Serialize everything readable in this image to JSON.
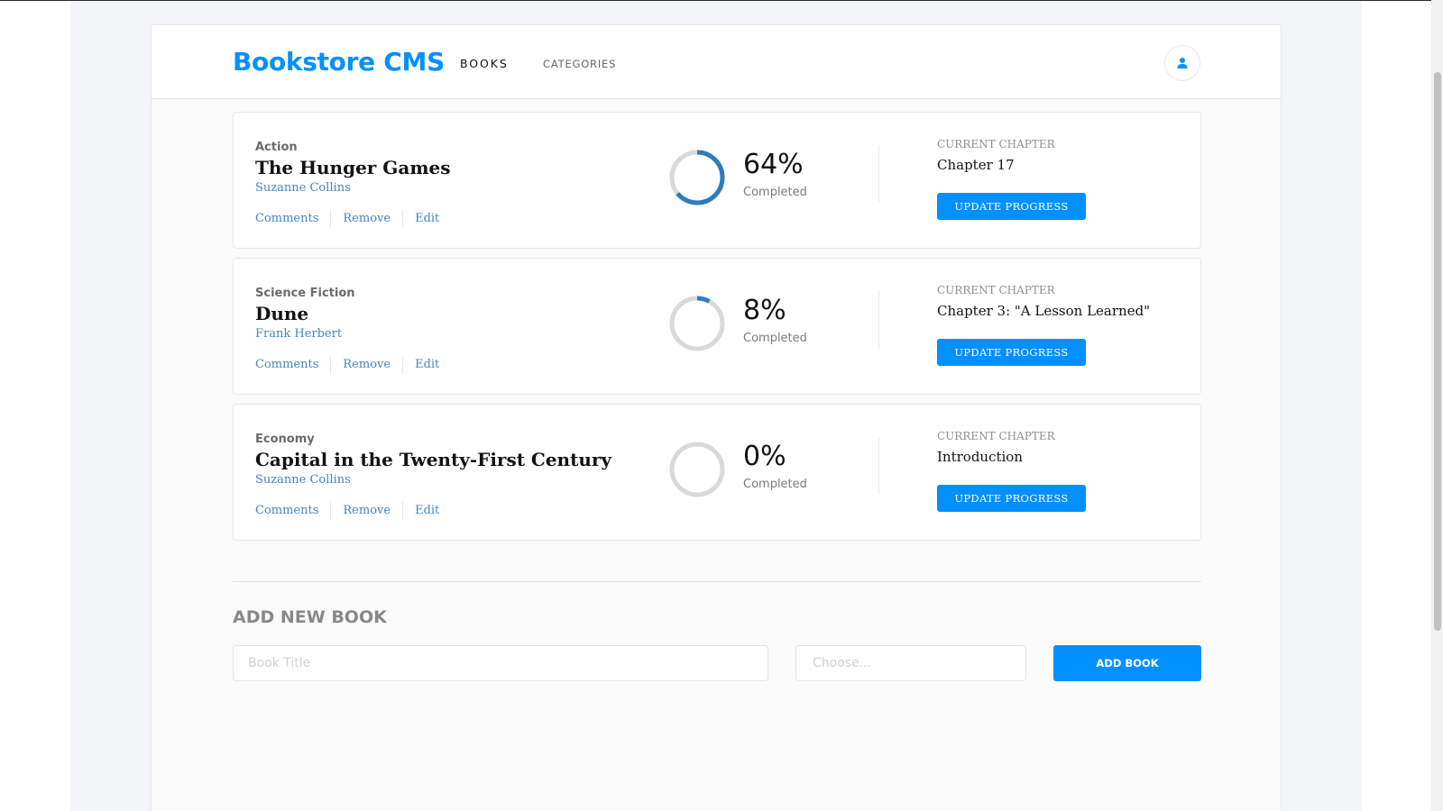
{
  "app": {
    "logo": "Bookstore CMS",
    "accent_color": "#0290ff"
  },
  "nav": {
    "books": "BOOKS",
    "categories": "CATEGORIES"
  },
  "user": {
    "icon": "user-icon"
  },
  "books": [
    {
      "genre": "Action",
      "title": "The Hunger Games",
      "author": "Suzanne Collins",
      "actions": [
        "Comments",
        "Remove",
        "Edit"
      ],
      "progress": 64,
      "progress_label": "64%",
      "completed_label": "Completed",
      "current_chapter_label": "CURRENT CHAPTER",
      "current_chapter": "Chapter 17",
      "update_label": "UPDATE PROGRESS"
    },
    {
      "genre": "Science Fiction",
      "title": "Dune",
      "author": "Frank Herbert",
      "actions": [
        "Comments",
        "Remove",
        "Edit"
      ],
      "progress": 8,
      "progress_label": "8%",
      "completed_label": "Completed",
      "current_chapter_label": "CURRENT CHAPTER",
      "current_chapter": "Chapter 3: \"A Lesson Learned\"",
      "update_label": "UPDATE PROGRESS"
    },
    {
      "genre": "Economy",
      "title": "Capital in the Twenty-First Century",
      "author": "Suzanne Collins",
      "actions": [
        "Comments",
        "Remove",
        "Edit"
      ],
      "progress": 0,
      "progress_label": "0%",
      "completed_label": "Completed",
      "current_chapter_label": "CURRENT CHAPTER",
      "current_chapter": "Introduction",
      "update_label": "UPDATE PROGRESS"
    }
  ],
  "add_book": {
    "heading": "ADD NEW BOOK",
    "title_placeholder": "Book Title",
    "category_placeholder": "Choose...",
    "button_label": "ADD BOOK"
  }
}
